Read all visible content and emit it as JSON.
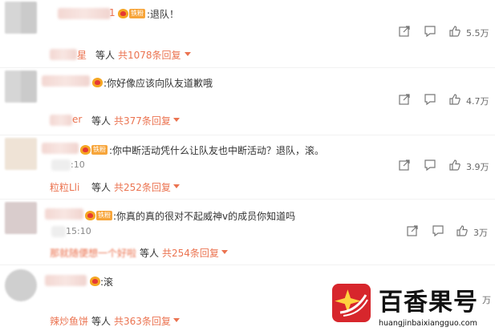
{
  "comments": [
    {
      "text": ":退队！",
      "time": "",
      "fan_badge": "铁粉",
      "likes": "5.5万",
      "replies": {
        "user": "星",
        "mid": "等人",
        "count": "共1078条回复"
      }
    },
    {
      "text": ":你好像应该向队友道歉哦",
      "time": "",
      "fan_badge": "",
      "likes": "4.7万",
      "replies": {
        "user": "er",
        "mid": "等人",
        "count": "共377条回复"
      }
    },
    {
      "text": ":你中断活动凭什么让队友也中断活动？退队，滚。",
      "time": ":10",
      "fan_badge": "铁粉",
      "likes": "3.9万",
      "replies": {
        "user": "粒粒Lli",
        "mid": "等人",
        "count": "共252条回复"
      }
    },
    {
      "text": ":你真的真的很对不起威神v的成员你知道吗",
      "time": "15:10",
      "fan_badge": "铁粉",
      "likes": "3万",
      "replies": {
        "user": "那就随便想一个好啦",
        "mid": "等人",
        "count": "共254条回复"
      }
    },
    {
      "text": ":滚",
      "time": "",
      "fan_badge": "",
      "likes": "万",
      "replies": {
        "user": "辣炒鱼饼",
        "mid": "等人",
        "count": "共363条回复"
      }
    }
  ],
  "first_comment_name_fragment": "1",
  "icons": {
    "forward": "forward-icon",
    "comment": "comment-icon",
    "like": "thumbs-up-icon"
  },
  "colors": {
    "link": "#eb7350",
    "badge": "#f7a53a",
    "watermark_red": "#d7262c"
  },
  "watermark": {
    "title": "百香果号",
    "url": "huangjinbaixiangguo.com"
  }
}
